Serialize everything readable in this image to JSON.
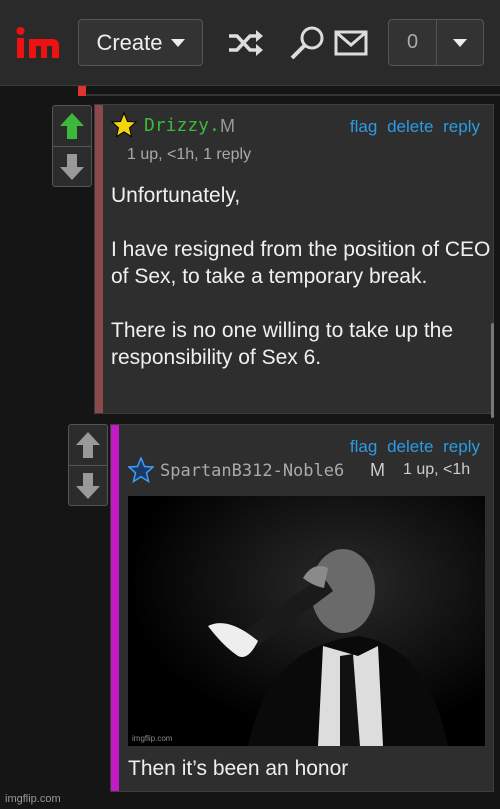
{
  "header": {
    "logo_text": "im",
    "create_label": "Create",
    "notifications_count": "0"
  },
  "comment1": {
    "username": "Drizzy.",
    "gender": "M",
    "meta": "1 up, <1h, 1 reply",
    "actions": [
      "flag",
      "delete",
      "reply"
    ],
    "paragraphs": [
      "Unfortunately,",
      "I have resigned from the position of CEO of Sex, to take a temporary break.",
      "There is no one willing to take up the responsibility of Sex 6."
    ]
  },
  "comment2": {
    "username": "SpartanB312-Noble6",
    "gender": "M",
    "meta": "1 up, <1h",
    "actions": [
      "flag",
      "delete",
      "reply"
    ],
    "image_watermark": "imgflip.com",
    "caption": "Then it’s been an honor"
  },
  "footer": {
    "watermark": "imgflip.com"
  },
  "colors": {
    "accent_link": "#2b9be6",
    "upvote": "#3cb93c",
    "stripe1": "#8b4a4a",
    "stripe2": "#c21bc6",
    "brand_red": "#e11"
  }
}
